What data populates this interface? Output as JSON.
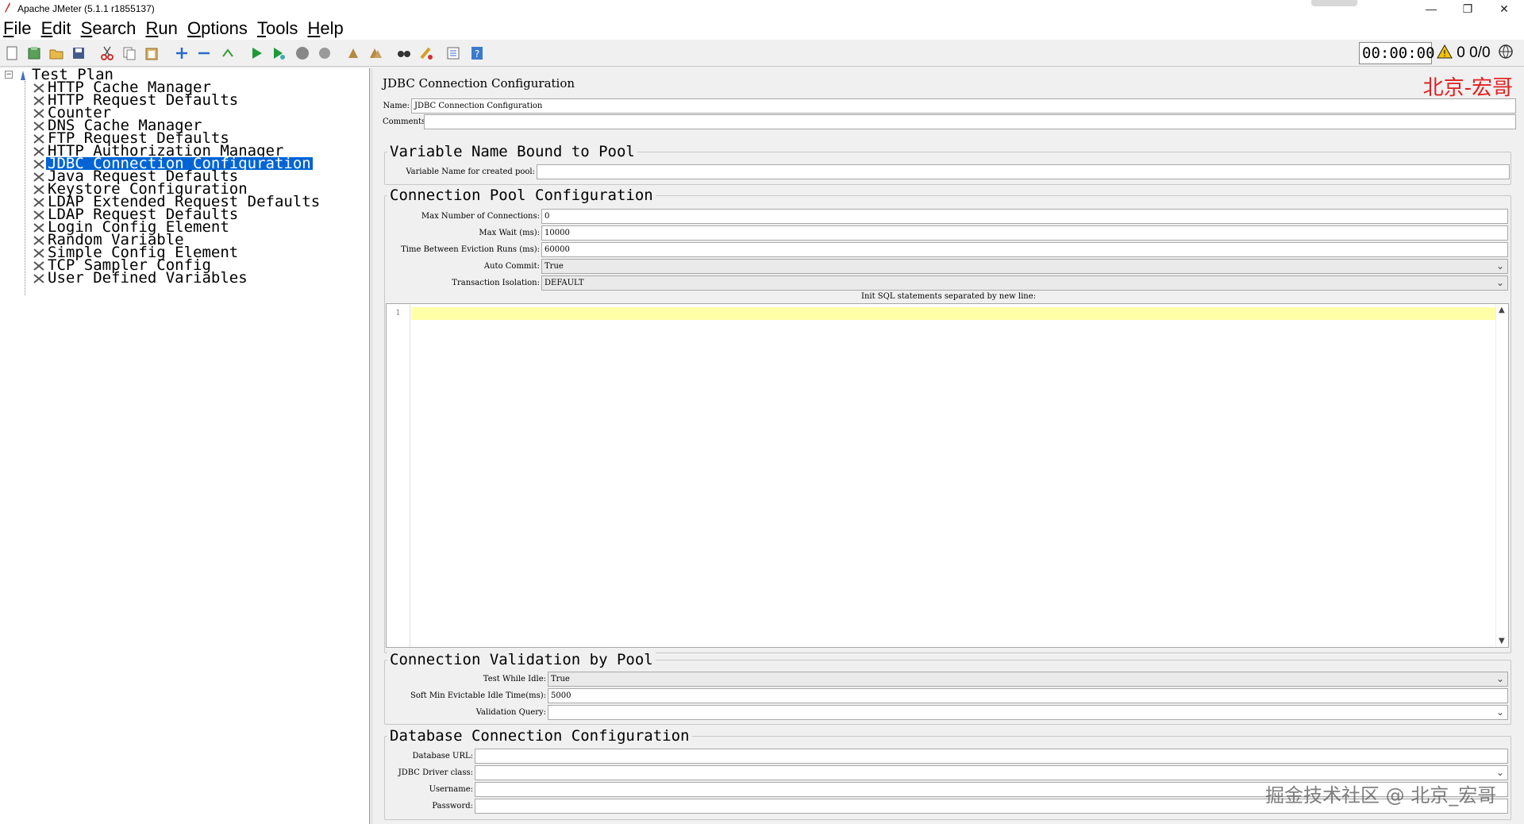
{
  "window": {
    "title": "Apache JMeter (5.1.1 r1855137)",
    "minimize": "—",
    "restore": "❐",
    "close": "✕"
  },
  "menu": [
    "File",
    "Edit",
    "Search",
    "Run",
    "Options",
    "Tools",
    "Help"
  ],
  "toolbar": {
    "icons": [
      "new-icon",
      "templates-icon",
      "open-icon",
      "save-icon",
      "cut-icon",
      "copy-icon",
      "paste-icon",
      "expand-icon",
      "collapse-icon",
      "toggle-icon",
      "start-icon",
      "start-no-pause-icon",
      "stop-icon",
      "shutdown-icon",
      "clear-icon",
      "clear-all-icon",
      "search-icon",
      "reset-search-icon",
      "function-helper-icon",
      "help-icon"
    ],
    "timer": "00:00:00",
    "error_count": "0",
    "thread_count": "0/0"
  },
  "tree": {
    "root": "Test Plan",
    "items": [
      "HTTP Cache Manager",
      "HTTP Request Defaults",
      "Counter",
      "DNS Cache Manager",
      "FTP Request Defaults",
      "HTTP Authorization Manager",
      "JDBC Connection Configuration",
      "Java Request Defaults",
      "Keystore Configuration",
      "LDAP Extended Request Defaults",
      "LDAP Request Defaults",
      "Login Config Element",
      "Random Variable",
      "Simple Config Element",
      "TCP Sampler Config",
      "User Defined Variables"
    ],
    "selected_index": 6
  },
  "panel": {
    "title": "JDBC Connection Configuration",
    "watermark_top": "北京-宏哥",
    "name_label": "Name:",
    "name_value": "JDBC Connection Configuration",
    "comments_label": "Comments:",
    "comments_value": "",
    "var_group": {
      "title": "Variable Name Bound to Pool",
      "var_label": "Variable Name for created pool:",
      "var_value": ""
    },
    "pool_group": {
      "title": "Connection Pool Configuration",
      "max_conn_label": "Max Number of Connections:",
      "max_conn_value": "0",
      "max_wait_label": "Max Wait (ms):",
      "max_wait_value": "10000",
      "eviction_label": "Time Between Eviction Runs (ms):",
      "eviction_value": "60000",
      "auto_commit_label": "Auto Commit:",
      "auto_commit_value": "True",
      "isolation_label": "Transaction Isolation:",
      "isolation_value": "DEFAULT",
      "init_sql_label": "Init SQL statements separated by new line:",
      "line_number": "1"
    },
    "validation_group": {
      "title": "Connection Validation by Pool",
      "test_idle_label": "Test While Idle:",
      "test_idle_value": "True",
      "soft_min_label": "Soft Min Evictable Idle Time(ms):",
      "soft_min_value": "5000",
      "validation_query_label": "Validation Query:",
      "validation_query_value": ""
    },
    "db_group": {
      "title": "Database Connection Configuration",
      "url_label": "Database URL:",
      "url_value": "",
      "driver_label": "JDBC Driver class:",
      "driver_value": "",
      "username_label": "Username:",
      "username_value": "",
      "password_label": "Password:",
      "password_value": ""
    }
  },
  "watermark_bottom": "掘金技术社区 @ 北京_宏哥"
}
